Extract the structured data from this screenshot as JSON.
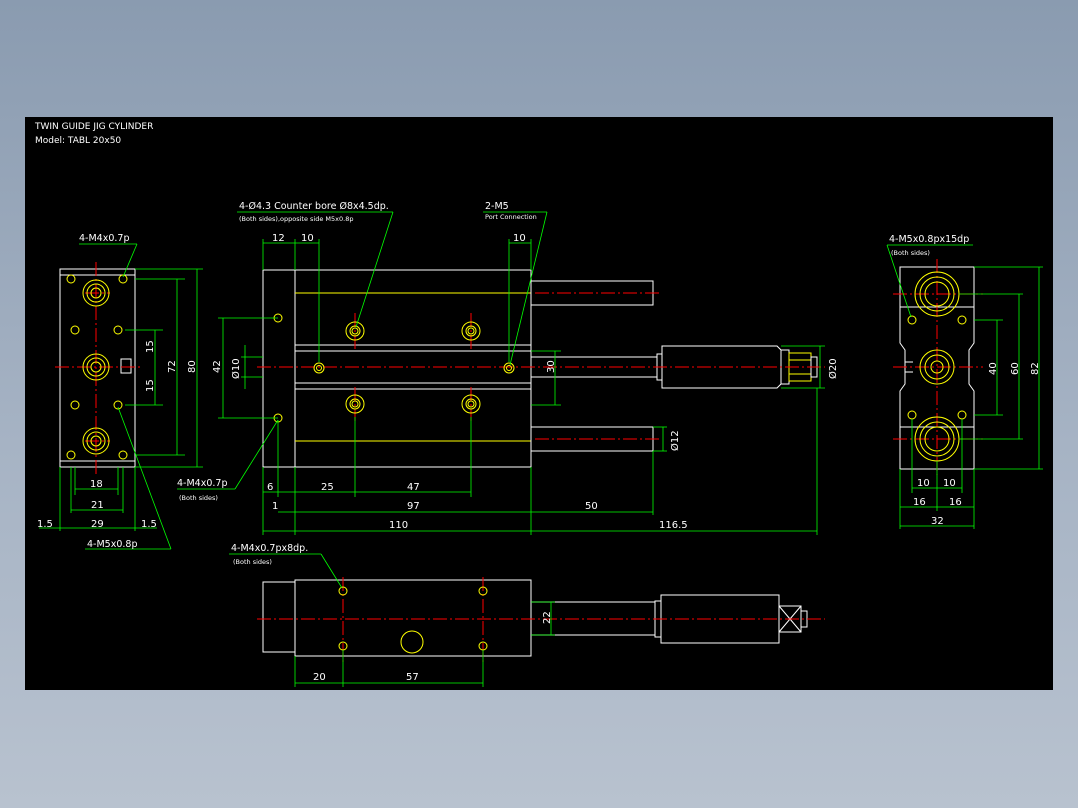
{
  "title": "TWIN GUIDE JIG CYLINDER",
  "model": "Model: TABL 20x50",
  "callouts": {
    "counterbore_main": "4-Ø4.3  Counter bore Ø8x4.5dp.",
    "counterbore_sub": "(Both sides),opposite side M5x0.8p",
    "port_main": "2-M5",
    "port_sub": "Port Connection",
    "left_top_tap": "4-M4x0.7p",
    "left_bottom_tap": "4-M5x0.8p",
    "front_tap_main": "4-M4x0.7p",
    "front_tap_sub": "(Both sides)",
    "right_tap_main": "4-M5x0.8px15dp",
    "right_tap_sub": "(Both sides)",
    "bottom_tap_main": "4-M4x0.7px8dp.",
    "bottom_tap_sub": "(Both sides)"
  },
  "dims": {
    "left_view": {
      "d15a": "15",
      "d15b": "15",
      "d72": "72",
      "d80": "80",
      "d18": "18",
      "d21": "21",
      "d29": "29",
      "d1_5a": "1.5",
      "d1_5b": "1.5"
    },
    "front_view": {
      "d12": "12",
      "d10a": "10",
      "d10b": "10",
      "d42": "42",
      "phi10": "Ø10",
      "d30": "30",
      "phi20": "Ø20",
      "phi12": "Ø12",
      "d6": "6",
      "d25": "25",
      "d47": "47",
      "d1": "1",
      "d97": "97",
      "d50": "50",
      "d110": "110",
      "d116_5": "116.5"
    },
    "right_view": {
      "d40": "40",
      "d60": "60",
      "d82": "82",
      "d10a": "10",
      "d10b": "10",
      "d16a": "16",
      "d16b": "16",
      "d32": "32"
    },
    "bottom_view": {
      "d22": "22",
      "d20": "20",
      "d57": "57"
    }
  },
  "colors": {
    "background": "#000000",
    "outline": "#ffffff",
    "dimension": "#00ff00",
    "centerline": "#ff0000",
    "feature": "#ffff00"
  }
}
